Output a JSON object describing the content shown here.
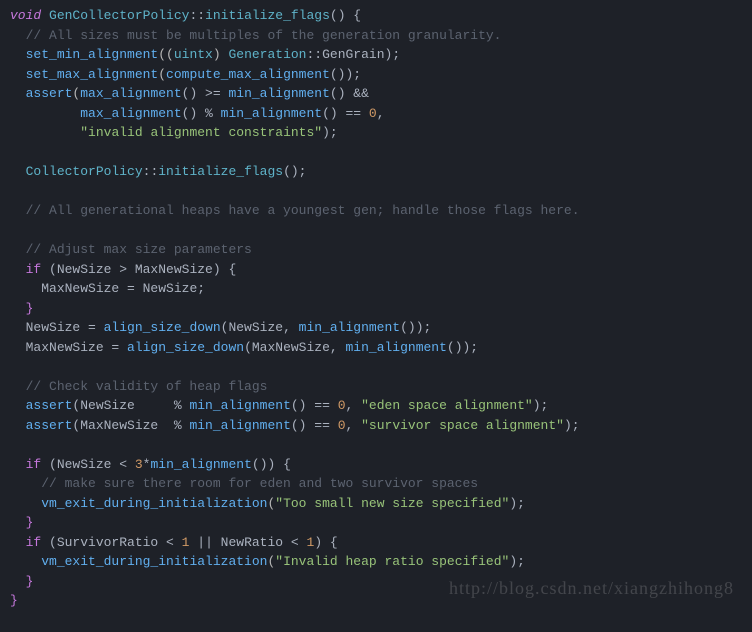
{
  "code": {
    "l1_void": "void",
    "l1_class": "GenCollectorPolicy",
    "l1_scope": "::",
    "l1_method": "initialize_flags",
    "l1_end": "() {",
    "l2_comment": "// All sizes must be multiples of the generation granularity.",
    "l3_func": "set_min_alignment",
    "l3_p1": "((",
    "l3_type": "uintx",
    "l3_p2": ") ",
    "l3_gen": "Generation",
    "l3_scope": "::",
    "l3_grain": "GenGrain",
    "l3_end": ");",
    "l4_func": "set_max_alignment",
    "l4_p1": "(",
    "l4_call": "compute_max_alignment",
    "l4_end": "());",
    "l5_assert": "assert",
    "l5_p1": "(",
    "l5_max": "max_alignment",
    "l5_p2": "() >= ",
    "l5_min": "min_alignment",
    "l5_p3": "() &&",
    "l6_max": "max_alignment",
    "l6_p1": "() % ",
    "l6_min": "min_alignment",
    "l6_p2": "() == ",
    "l6_zero": "0",
    "l6_end": ",",
    "l7_str": "\"invalid alignment constraints\"",
    "l7_end": ");",
    "l9_class": "CollectorPolicy",
    "l9_scope": "::",
    "l9_method": "initialize_flags",
    "l9_end": "();",
    "l11_comment": "// All generational heaps have a youngest gen; handle those flags here.",
    "l13_comment": "// Adjust max size parameters",
    "l14_if": "if",
    "l14_cond": " (NewSize > MaxNewSize) {",
    "l15_body": "MaxNewSize = NewSize;",
    "l16_brace": "}",
    "l17_var": "NewSize = ",
    "l17_func": "align_size_down",
    "l17_p1": "(NewSize, ",
    "l17_min": "min_alignment",
    "l17_end": "());",
    "l18_var": "MaxNewSize = ",
    "l18_func": "align_size_down",
    "l18_p1": "(MaxNewSize, ",
    "l18_min": "min_alignment",
    "l18_end": "());",
    "l20_comment": "// Check validity of heap flags",
    "l21_assert": "assert",
    "l21_p1": "(NewSize     % ",
    "l21_min": "min_alignment",
    "l21_p2": "() == ",
    "l21_zero": "0",
    "l21_p3": ", ",
    "l21_str": "\"eden space alignment\"",
    "l21_end": ");",
    "l22_assert": "assert",
    "l22_p1": "(MaxNewSize  % ",
    "l22_min": "min_alignment",
    "l22_p2": "() == ",
    "l22_zero": "0",
    "l22_p3": ", ",
    "l22_str": "\"survivor space alignment\"",
    "l22_end": ");",
    "l24_if": "if",
    "l24_p1": " (NewSize < ",
    "l24_three": "3",
    "l24_p2": "*",
    "l24_min": "min_alignment",
    "l24_end": "()) {",
    "l25_comment": "// make sure there room for eden and two survivor spaces",
    "l26_func": "vm_exit_during_initialization",
    "l26_p1": "(",
    "l26_str": "\"Too small new size specified\"",
    "l26_end": ");",
    "l27_brace": "}",
    "l28_if": "if",
    "l28_p1": " (SurvivorRatio < ",
    "l28_one1": "1",
    "l28_p2": " || NewRatio < ",
    "l28_one2": "1",
    "l28_end": ") {",
    "l29_func": "vm_exit_during_initialization",
    "l29_p1": "(",
    "l29_str": "\"Invalid heap ratio specified\"",
    "l29_end": ");",
    "l30_brace": "}",
    "l31_brace": "}"
  },
  "watermark": "http://blog.csdn.net/xiangzhihong8"
}
